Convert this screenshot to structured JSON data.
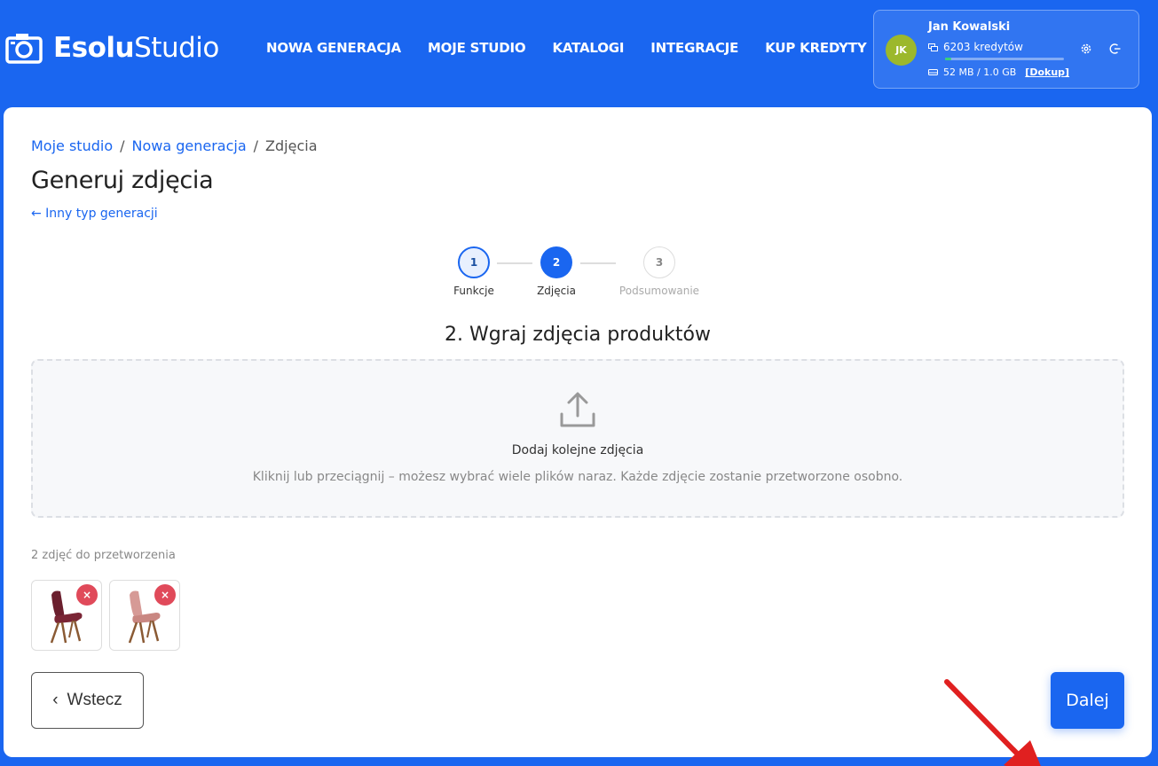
{
  "app": {
    "logo_bold": "Esolu",
    "logo_light": "Studio"
  },
  "nav": [
    {
      "label": "NOWA GENERACJA"
    },
    {
      "label": "MOJE STUDIO"
    },
    {
      "label": "KATALOGI"
    },
    {
      "label": "INTEGRACJE"
    },
    {
      "label": "KUP KREDYTY"
    }
  ],
  "user": {
    "initials": "JK",
    "name": "Jan Kowalski",
    "credits": "6203 kredytów",
    "storage": "52 MB / 1.0 GB",
    "topup": "[Dokup]",
    "storage_used_fraction": 0.05,
    "avatar_color": "#9cb82c"
  },
  "breadcrumb": {
    "items": [
      "Moje studio",
      "Nowa generacja",
      "Zdjęcia"
    ],
    "separator": "/"
  },
  "page": {
    "title": "Generuj zdjęcia",
    "back_link": "← Inny typ generacji"
  },
  "stepper": {
    "steps": [
      {
        "number": "1",
        "label": "Funkcje",
        "state": "done"
      },
      {
        "number": "2",
        "label": "Zdjęcia",
        "state": "active"
      },
      {
        "number": "3",
        "label": "Podsumowanie",
        "state": "pending"
      }
    ]
  },
  "upload": {
    "section_title": "2. Wgraj zdjęcia produktów",
    "title": "Dodaj kolejne zdjęcia",
    "subtitle": "Kliknij lub przeciągnij – możesz wybrać wiele plików naraz. Każde zdjęcie zostanie przetworzone osobno."
  },
  "photos": {
    "count_label": "2 zdjęć do przetworzenia",
    "items": [
      {
        "icon": "chair-burgundy",
        "color": "#6b1f2e"
      },
      {
        "icon": "chair-pink",
        "color": "#d69a96"
      }
    ],
    "remove_symbol": "×"
  },
  "actions": {
    "back_label": "Wstecz",
    "back_icon": "‹",
    "next_label": "Dalej"
  },
  "colors": {
    "brand": "#1a66f0",
    "danger": "#e04a5a",
    "annotation_arrow": "#e02020"
  }
}
